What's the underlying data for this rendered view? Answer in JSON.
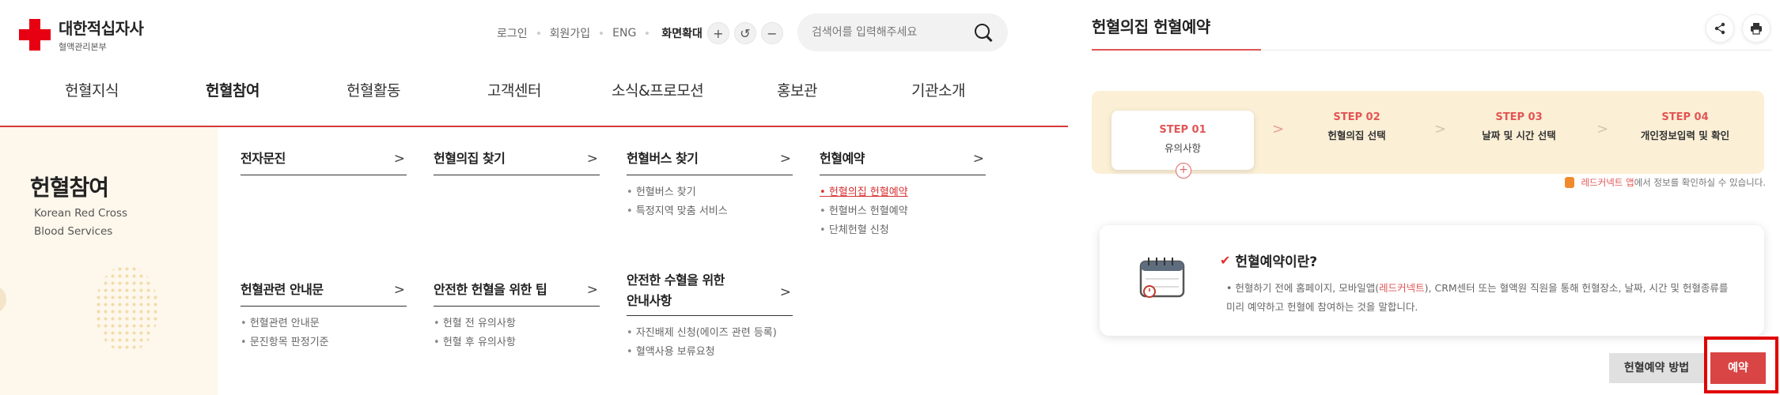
{
  "header": {
    "logo_main": "대한적십자사",
    "logo_sub": "혈액관리본부",
    "util_links": [
      "로그인",
      "회원가입",
      "ENG"
    ],
    "zoom_label": "화면확대",
    "zoom_in": "+",
    "zoom_reset": "↺",
    "zoom_out": "−",
    "search_placeholder": "검색어를 입력해주세요"
  },
  "gnb": [
    "헌혈지식",
    "헌혈참여",
    "헌혈활동",
    "고객센터",
    "소식&프로모션",
    "홍보관",
    "기관소개"
  ],
  "mega": {
    "side_title": "헌혈참여",
    "side_en_1": "Korean Red Cross",
    "side_en_2": "Blood Services",
    "chevron": ">",
    "columns": [
      {
        "title": "전자문진",
        "items": []
      },
      {
        "title": "헌혈의집 찾기",
        "items": []
      },
      {
        "title": "헌혈버스 찾기",
        "items": [
          "헌혈버스 찾기",
          "특정지역 맞춤 서비스"
        ]
      },
      {
        "title": "헌혈예약",
        "items": [
          "헌혈의집 헌혈예약",
          "헌혈버스 헌혈예약",
          "단체헌혈 신청"
        ]
      },
      {
        "title": "헌혈관련 안내문",
        "items": [
          "헌혈관련 안내문",
          "문진항목 판정기준"
        ]
      },
      {
        "title": "안전한 헌혈을 위한 팁",
        "items": [
          "헌혈 전 유의사항",
          "헌혈 후 유의사항"
        ]
      },
      {
        "title_1": "안전한 수혈을 위한",
        "title_2": "안내사항",
        "items": [
          "자진배제 신청(에이즈 관련 등록)",
          "혈액사용 보류요청"
        ]
      }
    ]
  },
  "right": {
    "title": "헌혈의집 헌혈예약",
    "steps": [
      {
        "num": "STEP 01",
        "label": "유의사항"
      },
      {
        "num": "STEP 02",
        "label": "헌혈의집 선택"
      },
      {
        "num": "STEP 03",
        "label": "날짜 및 시간 선택"
      },
      {
        "num": "STEP 04",
        "label": "개인정보입력 및 확인"
      }
    ],
    "step_plus": "+",
    "step_arrow": ">",
    "notice_app": "레드커넥트 앱",
    "notice_rest": "에서 정보를 확인하실 수 있습니다.",
    "info_title": "헌혈예약이란?",
    "info_text_1": "헌혈하기 전에 홈페이지, 모바일앱(",
    "info_text_hl": "레드커넥트",
    "info_text_2": "), CRM센터 또는 혈액원 직원을 통해 헌혈장소, 날짜, 시간 및 헌혈종류를 미리 예약하고 헌혈에 참여하는 것을 말합니다.",
    "btn_method": "헌혈예약 방법",
    "btn_book": "예약"
  },
  "colors": {
    "brand_red": "#e60012",
    "accent_red": "#d94545",
    "step_bg": "#fbefd6",
    "side_bg": "#fdf7ec"
  }
}
